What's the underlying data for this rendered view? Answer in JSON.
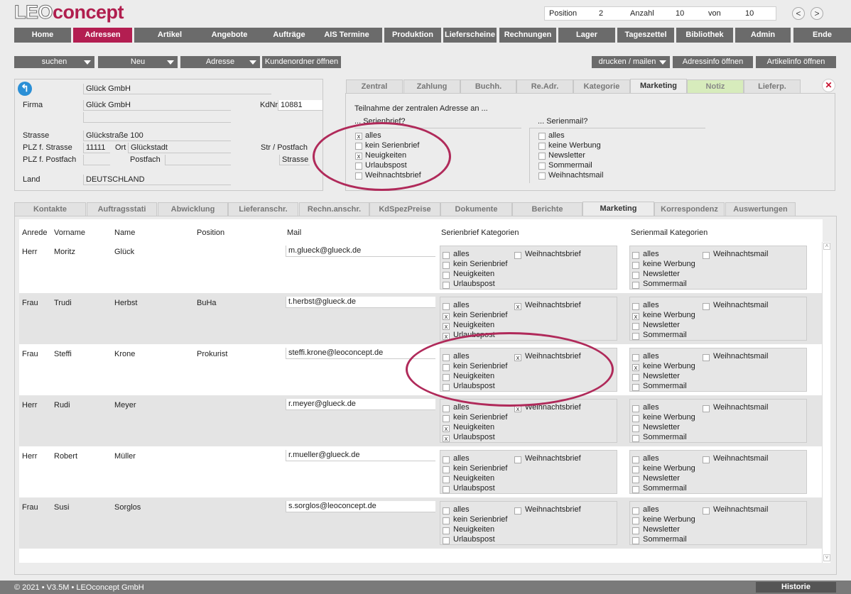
{
  "app": {
    "logo_leo": "LEO",
    "logo_concept": "concept"
  },
  "navinfo": {
    "position_label": "Position",
    "position_value": "2",
    "anzahl_label": "Anzahl",
    "anzahl_value": "10",
    "von_label": "von",
    "von_value": "10",
    "prev": "<",
    "next": ">"
  },
  "mainnav": [
    "Home",
    "Adressen",
    "Artikel",
    "Angebote",
    "Aufträge",
    "AIS Termine",
    "Produktion",
    "Lieferscheine",
    "Rechnungen",
    "Lager",
    "Tageszettel",
    "Bibliothek",
    "Admin",
    "Ende"
  ],
  "toolbar": {
    "suchen": "suchen",
    "neu": "Neu",
    "adresse": "Adresse",
    "kundenordner": "Kundenordner öffnen",
    "drucken": "drucken / mailen",
    "adressinfo": "Adressinfo öffnen",
    "artikelinfo": "Artikelinfo öffnen"
  },
  "address": {
    "name1": "Glück GmbH",
    "firma_label": "Firma",
    "firma": "Glück GmbH",
    "kdnr_label": "KdNr",
    "kdnr": "10881",
    "strasse_label": "Strasse",
    "strasse": "Glückstraße 100",
    "plz_str_label": "PLZ f. Strasse",
    "plz": "11111",
    "ort_label": "Ort",
    "ort": "Glückstadt",
    "str_postfach_label": "Str / Postfach",
    "plz_postfach_label": "PLZ f. Postfach",
    "postfach_label": "Postfach",
    "str_value": "Strasse",
    "land_label": "Land",
    "land": "DEUTSCHLAND"
  },
  "toptabs": [
    "Zentral",
    "Zahlung",
    "Buchh.",
    "Re.Adr.",
    "Kategorie",
    "Marketing",
    "Notiz",
    "Lieferp."
  ],
  "marketing": {
    "intro": "Teilnahme der zentralen Adresse an ...",
    "serienbrief_title": "... Serienbrief?",
    "serienmail_title": "... Serienmail?",
    "serienbrief": [
      {
        "label": "alles",
        "checked": true
      },
      {
        "label": "kein Serienbrief",
        "checked": false
      },
      {
        "label": "Neuigkeiten",
        "checked": true
      },
      {
        "label": "Urlaubspost",
        "checked": false
      },
      {
        "label": "Weihnachtsbrief",
        "checked": false
      }
    ],
    "serienmail": [
      {
        "label": "alles",
        "checked": false
      },
      {
        "label": "keine Werbung",
        "checked": false
      },
      {
        "label": "Newsletter",
        "checked": false
      },
      {
        "label": "Sommermail",
        "checked": false
      },
      {
        "label": "Weihnachtsmail",
        "checked": false
      }
    ]
  },
  "bottomtabs": [
    "Kontakte",
    "Auftragsstati",
    "Abwicklung",
    "Lieferanschr.",
    "Rechn.anschr.",
    "KdSpezPreise",
    "Dokumente",
    "Berichte",
    "Marketing",
    "Korrespondenz",
    "Auswertungen"
  ],
  "table": {
    "headers": {
      "anrede": "Anrede",
      "vorname": "Vorname",
      "name": "Name",
      "position": "Position",
      "mail": "Mail",
      "sb": "Serienbrief Kategorien",
      "sm": "Serienmail Kategorien"
    },
    "sb_labels": [
      "alles",
      "kein Serienbrief",
      "Neuigkeiten",
      "Urlaubspost",
      "Weihnachtsbrief"
    ],
    "sm_labels": [
      "alles",
      "keine Werbung",
      "Newsletter",
      "Sommermail",
      "Weihnachtsmail"
    ],
    "rows": [
      {
        "anrede": "Herr",
        "vorname": "Moritz",
        "name": "Glück",
        "position": "",
        "mail": "m.glueck@glueck.de",
        "sb": [
          false,
          false,
          false,
          false,
          false
        ],
        "sm": [
          false,
          false,
          false,
          false,
          false
        ]
      },
      {
        "anrede": "Frau",
        "vorname": "Trudi",
        "name": "Herbst",
        "position": "BuHa",
        "mail": "t.herbst@glueck.de",
        "sb": [
          false,
          true,
          true,
          true,
          true
        ],
        "sm": [
          false,
          true,
          false,
          false,
          false
        ]
      },
      {
        "anrede": "Frau",
        "vorname": "Steffi",
        "name": "Krone",
        "position": "Prokurist",
        "mail": "steffi.krone@leoconcept.de",
        "sb": [
          false,
          false,
          false,
          false,
          true
        ],
        "sm": [
          false,
          true,
          false,
          false,
          false
        ]
      },
      {
        "anrede": "Herr",
        "vorname": "Rudi",
        "name": "Meyer",
        "position": "",
        "mail": "r.meyer@glueck.de",
        "sb": [
          false,
          false,
          true,
          true,
          true
        ],
        "sm": [
          false,
          false,
          false,
          false,
          false
        ]
      },
      {
        "anrede": "Herr",
        "vorname": "Robert",
        "name": "Müller",
        "position": "",
        "mail": "r.mueller@glueck.de",
        "sb": [
          false,
          false,
          false,
          false,
          false
        ],
        "sm": [
          false,
          false,
          false,
          false,
          false
        ]
      },
      {
        "anrede": "Frau",
        "vorname": "Susi",
        "name": "Sorglos",
        "position": "",
        "mail": "s.sorglos@leoconcept.de",
        "sb": [
          false,
          false,
          false,
          false,
          false
        ],
        "sm": [
          false,
          false,
          false,
          false,
          false
        ]
      }
    ]
  },
  "footer": {
    "copyright": "© 2021 • V3.5M • LEOconcept GmbH",
    "historie": "Historie"
  },
  "colors": {
    "accent": "#b31e51",
    "nav": "#6b6b6b",
    "notiz": "#d7ecbc",
    "highlight": "#b02a5a"
  }
}
